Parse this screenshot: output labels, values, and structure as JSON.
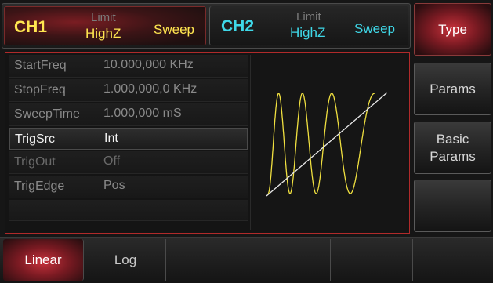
{
  "channels": {
    "ch1": {
      "name": "CH1",
      "limit": "Limit",
      "impedance": "HighZ",
      "mode": "Sweep"
    },
    "ch2": {
      "name": "CH2",
      "limit": "Limit",
      "impedance": "HighZ",
      "mode": "Sweep"
    }
  },
  "softkeys": {
    "type": "Type",
    "params": "Params",
    "basic_params_line1": "Basic",
    "basic_params_line2": "Params",
    "blank": ""
  },
  "params": [
    {
      "name": "StartFreq",
      "value": "10.000,000 KHz"
    },
    {
      "name": "StopFreq",
      "value": "1.000,000,0 KHz"
    },
    {
      "name": "SweepTime",
      "value": "1.000,000 mS"
    },
    {
      "name": "TrigSrc",
      "value": "Int"
    },
    {
      "name": "TrigOut",
      "value": "Off"
    },
    {
      "name": "TrigEdge",
      "value": "Pos"
    }
  ],
  "bottom_keys": {
    "linear": "Linear",
    "log": "Log"
  },
  "colors": {
    "ch1": "#ffe650",
    "ch2": "#3fd8e8",
    "accent": "#c8323c",
    "wave": "#f0e040"
  },
  "preview": {
    "sweep": "linear",
    "trace": "sweep-waveform"
  }
}
